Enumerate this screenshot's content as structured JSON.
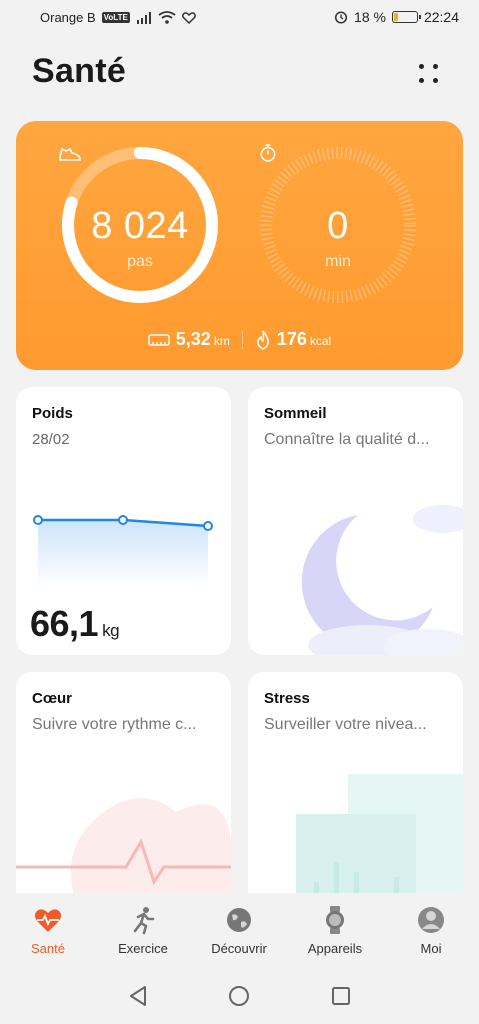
{
  "status_bar": {
    "carrier": "Orange B",
    "volte": "VoLTE",
    "battery_percent": "18 %",
    "time": "22:24",
    "battery_level": 0.18
  },
  "header": {
    "title": "Santé",
    "menu_icon": "grid-dots-icon"
  },
  "activity": {
    "steps_value": "8 024",
    "steps_unit": "pas",
    "steps_progress": 0.8,
    "minutes_value": "0",
    "minutes_unit": "min",
    "distance_value": "5,32",
    "distance_unit": "km",
    "calories_value": "176",
    "calories_unit": "kcal"
  },
  "cards": {
    "weight": {
      "title": "Poids",
      "date": "28/02",
      "value": "66,1",
      "unit": "kg"
    },
    "sleep": {
      "title": "Sommeil",
      "subtitle": "Connaître la qualité d..."
    },
    "heart": {
      "title": "Cœur",
      "subtitle": "Suivre votre rythme c..."
    },
    "stress": {
      "title": "Stress",
      "subtitle": "Surveiller votre nivea..."
    }
  },
  "nav": {
    "items": [
      {
        "label": "Santé",
        "icon": "heart-pulse-icon",
        "active": true
      },
      {
        "label": "Exercice",
        "icon": "runner-icon",
        "active": false
      },
      {
        "label": "Découvrir",
        "icon": "globe-icon",
        "active": false
      },
      {
        "label": "Appareils",
        "icon": "watch-icon",
        "active": false
      },
      {
        "label": "Moi",
        "icon": "user-icon",
        "active": false
      }
    ]
  },
  "colors": {
    "accent": "#ff9a2f",
    "active_tab": "#f25a2c",
    "chart_line": "#1e88e5"
  }
}
